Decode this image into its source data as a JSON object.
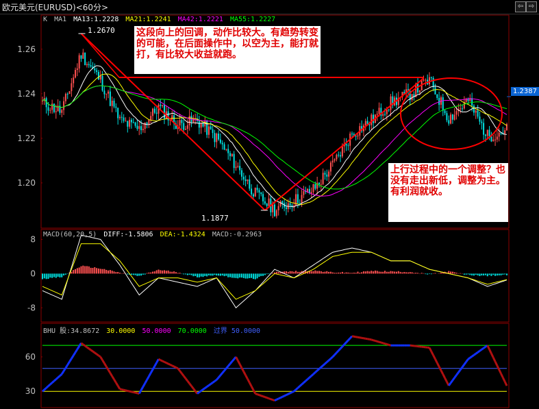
{
  "window": {
    "title": "欧元美元(EURUSD)<60分>",
    "btn_prev": "⇦",
    "btn_next": "⇨",
    "btn_close": "✕"
  },
  "price_legend": {
    "k": "K",
    "ma1": "MA1",
    "ma13": "MA13:1.2228",
    "ma21": "MA21:1.2241",
    "ma42": "MA42:1.2221",
    "ma55": "MA55:1.2227"
  },
  "macd_legend": {
    "name": "MACD(60,20,5)",
    "diff": "DIFF:-1.5806",
    "dea": "DEA:-1.4324",
    "macd": "MACD:-0.2963"
  },
  "bhu_legend": {
    "name": "BHU 股:34.8672",
    "v30": "30.0000",
    "v50": "50.0000",
    "v70": "70.0000",
    "guojie": "过界 50.0000"
  },
  "annotations": {
    "note1": "这段向上的回调，动作比较大。有趋势转变的可能，在后面操作中，以空为主，能打就打，有比较大收益就跑。",
    "note2": "上行过程中的一个调整？也没有走出新低，调整为主。有利润就收。",
    "high_label": "1.2670",
    "low_label": "1.1877",
    "last_price": "1.2387"
  },
  "colors": {
    "up": "#ff5050",
    "down": "#00e0e0",
    "ma13": "#ffffff",
    "ma21": "#ffff00",
    "ma42": "#ff00ff",
    "ma55": "#00ff00",
    "annotation": "#ff0000"
  },
  "chart_data": [
    {
      "type": "line",
      "name": "price",
      "x": [
        0,
        10,
        20,
        30,
        40,
        50,
        60,
        70,
        80,
        90,
        100,
        110,
        120,
        130,
        140,
        150,
        160,
        170,
        180,
        190,
        200,
        210,
        220,
        230,
        240
      ],
      "close": [
        1.236,
        1.232,
        1.258,
        1.246,
        1.228,
        1.224,
        1.234,
        1.226,
        1.228,
        1.22,
        1.208,
        1.195,
        1.188,
        1.192,
        1.197,
        1.208,
        1.222,
        1.228,
        1.236,
        1.24,
        1.246,
        1.229,
        1.237,
        1.221,
        1.224
      ],
      "ylim": [
        1.18,
        1.275
      ],
      "yticks": [
        "1.26",
        "1.24",
        "1.22",
        "1.20"
      ],
      "ytick_values": [
        1.26,
        1.24,
        1.22,
        1.2
      ],
      "high": 1.267,
      "low": 1.1877,
      "last": 1.2387
    },
    {
      "type": "bar",
      "name": "MACD",
      "x": [
        0,
        10,
        20,
        30,
        40,
        50,
        60,
        70,
        80,
        90,
        100,
        110,
        120,
        130,
        140,
        150,
        160,
        170,
        180,
        190,
        200,
        210,
        220,
        230,
        240
      ],
      "values": [
        -1.2,
        -0.8,
        1.8,
        1.2,
        0.2,
        -0.6,
        0.9,
        0.3,
        -0.8,
        -0.3,
        -1.0,
        -1.2,
        0.4,
        0.5,
        0.7,
        0.3,
        0.2,
        0.6,
        0.5,
        0.4,
        -0.2,
        0.5,
        -0.3,
        -0.5,
        -0.3
      ],
      "diff": [
        -4,
        -6,
        9,
        8,
        2,
        -5,
        -1,
        -2,
        -3,
        -1,
        -8,
        -4,
        1,
        -1,
        2,
        5,
        6,
        5,
        3,
        3,
        1,
        0,
        -1,
        -3,
        -1.5
      ],
      "dea": [
        -3,
        -5,
        7,
        7,
        3,
        -3,
        -1,
        -1,
        -2,
        -1,
        -6,
        -4,
        0,
        -1,
        1,
        4,
        5,
        5,
        3,
        3,
        1,
        0,
        -1,
        -2.5,
        -1.4
      ],
      "ylim": [
        -11,
        10
      ],
      "yticks": [
        "8",
        "0",
        "-8"
      ],
      "ytick_values": [
        8,
        0,
        -8
      ]
    },
    {
      "type": "line",
      "name": "BHU",
      "x": [
        0,
        10,
        20,
        30,
        40,
        50,
        60,
        70,
        80,
        90,
        100,
        110,
        120,
        130,
        140,
        150,
        160,
        170,
        180,
        190,
        200,
        210,
        220,
        230,
        240
      ],
      "values": [
        30,
        45,
        72,
        60,
        32,
        28,
        58,
        50,
        28,
        40,
        60,
        28,
        22,
        30,
        45,
        60,
        78,
        75,
        70,
        70,
        68,
        35,
        58,
        70,
        34.87
      ],
      "ylim": [
        17,
        88
      ],
      "levels": [
        30,
        50,
        70
      ],
      "yticks": [
        "60",
        "30"
      ],
      "ytick_values": [
        60,
        30
      ]
    }
  ]
}
